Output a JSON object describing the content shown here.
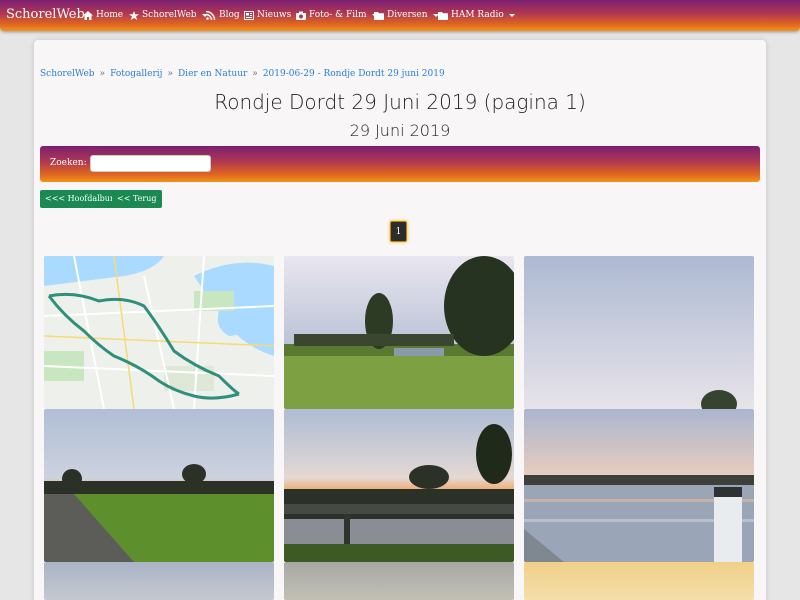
{
  "navbar": {
    "brand": "SchorelWeb",
    "items": [
      {
        "label": "Home",
        "icon": "home-icon",
        "dropdown": false
      },
      {
        "label": "SchorelWeb",
        "icon": "star-icon",
        "dropdown": true
      },
      {
        "label": "Blog",
        "icon": "rss-icon",
        "dropdown": false
      },
      {
        "label": "Nieuws",
        "icon": "newspaper-icon",
        "dropdown": false
      },
      {
        "label": "Foto- & Film",
        "icon": "camera-icon",
        "dropdown": true
      },
      {
        "label": "Diversen",
        "icon": "folder-icon",
        "dropdown": true
      },
      {
        "label": "HAM Radio",
        "icon": "folder-icon",
        "dropdown": true
      }
    ]
  },
  "breadcrumb": [
    "SchorelWeb",
    "Fotogallerij",
    "Dier en Natuur",
    "2019-06-29 - Rondje Dordt 29 juni 2019"
  ],
  "page": {
    "title": "Rondje Dordt 29 Juni 2019 (pagina 1)",
    "subtitle": "29 Juni 2019"
  },
  "search": {
    "label": "Zoeken:",
    "value": "",
    "placeholder": ""
  },
  "buttons": {
    "main_album": "<<< Hoofdalbum",
    "back": "<< Terug"
  },
  "pagination": {
    "current": "1"
  },
  "gallery": {
    "photos": [
      {
        "kind": "route-map"
      },
      {
        "kind": "meadow-sunset"
      },
      {
        "kind": "evening-sky"
      },
      {
        "kind": "path-sunset"
      },
      {
        "kind": "bridge-sunset"
      },
      {
        "kind": "river-sunset"
      },
      {
        "kind": "photo"
      },
      {
        "kind": "photo"
      },
      {
        "kind": "photo"
      }
    ]
  },
  "colors": {
    "brand_gradient_top": "#7b1e73",
    "brand_gradient_bottom": "#f3941a",
    "button_green": "#1a8a52",
    "link_blue": "#2a7fd4"
  }
}
